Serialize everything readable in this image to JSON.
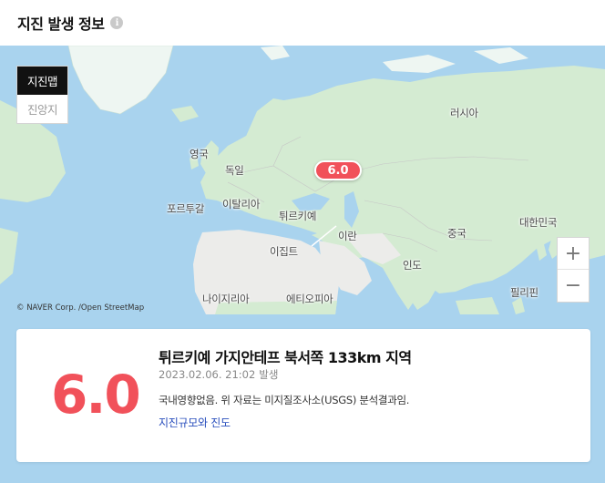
{
  "header": {
    "title": "지진 발생 정보",
    "info_icon": "info-icon"
  },
  "map": {
    "mode_toggle": [
      "지진맵",
      "진앙지"
    ],
    "active_mode": "지진맵",
    "labels": {
      "russia": "러시아",
      "uk": "영국",
      "germany": "독일",
      "portugal": "포르투갈",
      "italy": "이탈리아",
      "turkiye": "튀르키예",
      "iran": "이란",
      "china": "중국",
      "korea": "대한민국",
      "egypt": "이집트",
      "india": "인도",
      "philippines": "필리핀",
      "nigeria": "나이지리아",
      "ethiopia": "에티오피아"
    },
    "marker": "6.0",
    "zoom_in": "+",
    "zoom_out": "−",
    "copyright": "© NAVER Corp. /Open StreetMap",
    "colors": {
      "sea": "#a9d3ee",
      "land": "#d4ebd2",
      "desert": "#ececea",
      "marker": "#f1515a"
    }
  },
  "quake": {
    "magnitude": "6.0",
    "location": "튀르키예 가지안테프 북서쪽 133km 지역",
    "time": "2023.02.06. 21:02",
    "time_suffix": "발생",
    "note": "국내영향없음. 위 자료는 미지질조사소(USGS) 분석결과임.",
    "link": "지진규모와 진도"
  }
}
